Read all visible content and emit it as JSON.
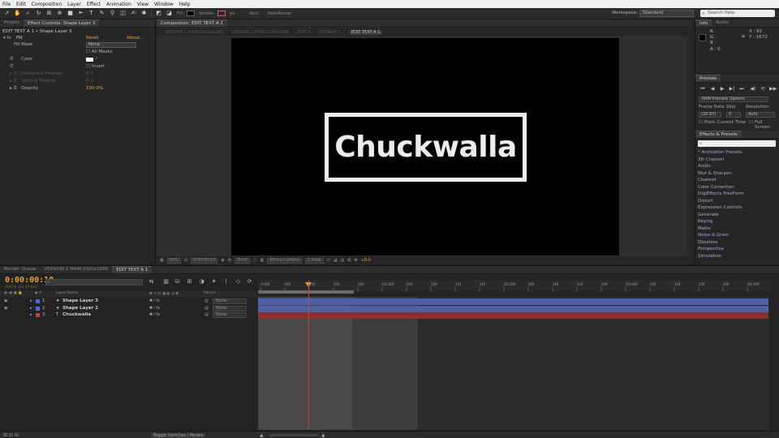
{
  "menubar": {
    "items": [
      "File",
      "Edit",
      "Composition",
      "Layer",
      "Effect",
      "Animation",
      "View",
      "Window",
      "Help"
    ]
  },
  "toolbar": {
    "fill_label": "Fill:",
    "stroke_label": "Stroke:",
    "stroke_px": "px",
    "add_label": "Add:",
    "rotobezier_label": "RotoBezier",
    "workspace_label": "Workspace:",
    "workspace_value": "Standard",
    "search_placeholder": "Search Help",
    "fill_color": "#000000",
    "stroke_color": "#d06060"
  },
  "effects_panel": {
    "tab_project": "Project",
    "tab_effects": "Effect Controls: Shape Layer 3",
    "layer_path": "EDIT TEXT A 1 • Shape Layer 3",
    "fx_name": "Fill",
    "reset": "Reset",
    "about": "About...",
    "fill_mask_label": "Fill Mask",
    "fill_mask_value": "None",
    "all_masks": "All Masks",
    "color_label": "Color",
    "invert_label": "Invert",
    "h_feather_label": "Horizontal Feather",
    "h_feather_value": "0.0",
    "v_feather_label": "Vertical Feather",
    "v_feather_value": "0.0",
    "opacity_label": "Opacity",
    "opacity_value": "100.0%"
  },
  "composition": {
    "tab_label": "Composition: EDIT TEXT A 1",
    "breadcrumbs": [
      "VERSION 1 MAIN 1920x1080",
      "VERSION 1 MAIN 1920x1080",
      "EDIT A",
      "PREMAIT A",
      "EDIT TEXT A 1"
    ],
    "title_text": "Chuckwalla",
    "zoom": "50%",
    "timecode": "0:00:00:10",
    "resolution": "Third",
    "camera": "Active Camera",
    "views": "1 View",
    "exposure": "+0.0"
  },
  "info_panel": {
    "tab_info": "Info",
    "tab_audio": "Audio",
    "r": "R :",
    "g": "G :",
    "b": "B :",
    "a": "A : 0",
    "x": "X : 82",
    "y": "Y : 1672"
  },
  "preview_panel": {
    "tab": "Preview",
    "ram_options": "RAM Preview Options",
    "frame_rate_label": "Frame Rate",
    "skip_label": "Skip",
    "resolution_label": "Resolution",
    "frame_rate_value": "(29.97)",
    "skip_value": "0",
    "resolution_value": "Auto",
    "from_current": "From Current Time",
    "full_screen": "Full Screen"
  },
  "fx_panel": {
    "tab": "Effects & Presets",
    "items": [
      "* Animation Presets",
      "3D Channel",
      "Audio",
      "Blur & Sharpen",
      "Channel",
      "Color Correction",
      "DigiEffects FreeForm",
      "Distort",
      "Expression Controls",
      "Generate",
      "Keying",
      "Matte",
      "Noise & Grain",
      "Obsolete",
      "Perspective",
      "Simulation"
    ]
  },
  "timeline": {
    "tab_render": "Render Queue",
    "tab_version": "VERSION 1 MAIN 1920x1080",
    "tab_edit": "EDIT TEXT A 1",
    "current_time": "0:00:00:10",
    "fps": "00010 (29.97 fps)",
    "col_layer_name": "Layer Name",
    "col_parent": "Parent",
    "layers": [
      {
        "num": "1",
        "name": "Shape Layer 3",
        "parent": "None",
        "color": "#4a6fd8"
      },
      {
        "num": "2",
        "name": "Shape Layer 2",
        "parent": "None",
        "color": "#4a6fd8"
      },
      {
        "num": "3",
        "name": "Chuckwalla",
        "parent": "None",
        "color": "#c83a3a"
      }
    ],
    "ruler_labels": [
      "0:00f",
      "05f",
      "10f",
      "15f",
      "20f",
      "01:00f",
      "05f",
      "10f",
      "15f",
      "20f",
      "02:00f",
      "05f",
      "10f",
      "15f",
      "20f",
      "03:00f",
      "05f",
      "10f",
      "15f",
      "20f",
      "04:00f",
      "05f"
    ],
    "toggle": "Toggle Switches / Modes"
  }
}
